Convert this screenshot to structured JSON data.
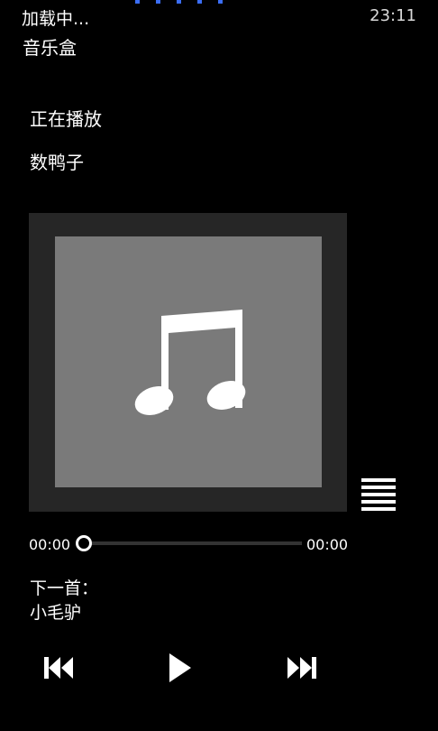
{
  "status_bar": {
    "loading_text": "加载中...",
    "clock": "23:11"
  },
  "app": {
    "title": "音乐盒"
  },
  "now_playing": {
    "label": "正在播放",
    "song_title": "数鸭子",
    "album_art_icon": "music-note-icon"
  },
  "player": {
    "current_time": "00:00",
    "total_time": "00:00",
    "progress": 0
  },
  "next_up": {
    "label": "下一首：",
    "song_title": "小毛驴"
  },
  "controls": {
    "previous_icon": "skip-previous-icon",
    "play_icon": "play-icon",
    "next_icon": "skip-next-icon",
    "playlist_icon": "playlist-icon"
  },
  "colors": {
    "background": "#000000",
    "progress_dots": "#3b6ef5",
    "art_frame": "#262626",
    "art_inner": "#7a7a7a"
  }
}
